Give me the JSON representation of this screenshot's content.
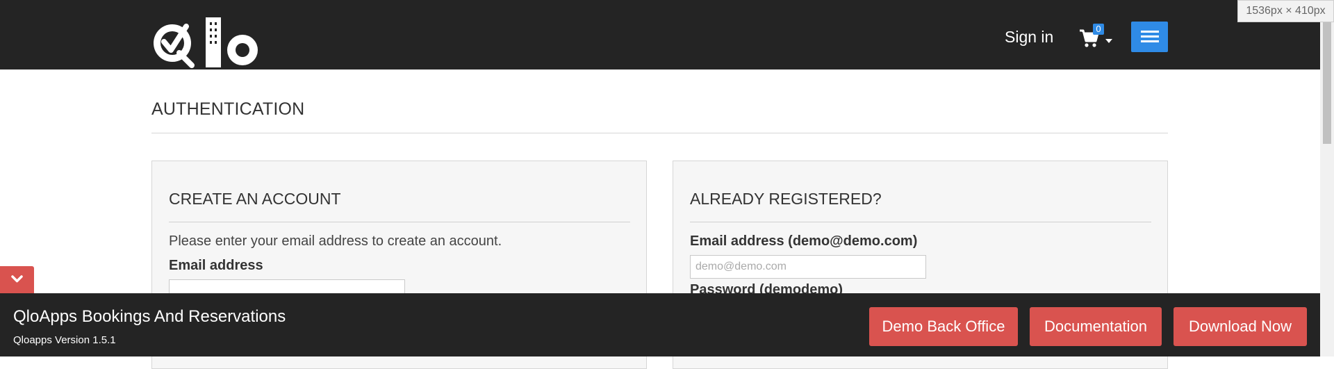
{
  "header": {
    "logo_text": "Qlo",
    "sign_in_label": "Sign in",
    "cart_count": "0",
    "icons": {
      "cart": "cart-icon",
      "caret": "caret-down-icon",
      "menu": "hamburger-menu-icon"
    },
    "accent_color": "#2f8be6"
  },
  "page": {
    "heading": "AUTHENTICATION"
  },
  "create_account": {
    "title": "CREATE AN ACCOUNT",
    "description": "Please enter your email address to create an account.",
    "email_label": "Email address",
    "email_value": ""
  },
  "already_registered": {
    "title": "ALREADY REGISTERED?",
    "email_label": "Email address (demo@demo.com)",
    "email_placeholder": "demo@demo.com",
    "password_label": "Password (demodemo)"
  },
  "footer": {
    "title": "QloApps Bookings And Reservations",
    "version": "Qloapps Version 1.5.1",
    "buttons": {
      "demo_back_office": "Demo Back Office",
      "documentation": "Documentation",
      "download_now": "Download Now"
    },
    "button_color": "#d9534f",
    "collapse_icon": "chevron-down-icon"
  },
  "viewport_info": "1536px × 410px"
}
